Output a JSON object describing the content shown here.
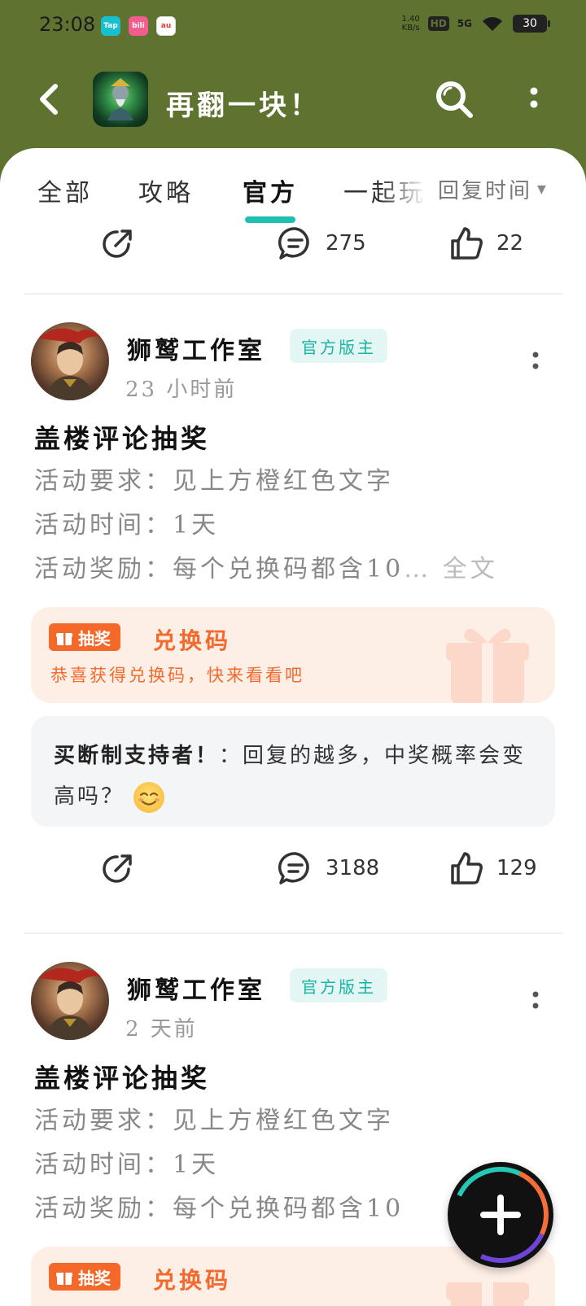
{
  "status_bar": {
    "time": "23:08",
    "apps": [
      {
        "name": "TapTap",
        "label": "Tap",
        "color": "#16c1cd"
      },
      {
        "name": "bilibili",
        "label": "bili",
        "color": "#f25d8e"
      },
      {
        "name": "au-app",
        "label": "au",
        "color": "#e63b2e"
      }
    ],
    "net_speed_top": "1.40",
    "net_speed_unit": "KB/s",
    "hd": "HD",
    "network": "5G",
    "battery": "30"
  },
  "header": {
    "game_title": "再翻一块！"
  },
  "tabs": {
    "items": [
      "全部",
      "攻略",
      "官方",
      "一起玩"
    ],
    "active_index": 2,
    "sort_label": "回复时间"
  },
  "top_actions": {
    "comments": "275",
    "likes": "22"
  },
  "posts": [
    {
      "author": "狮鹫工作室",
      "badge": "官方版主",
      "time": "23 小时前",
      "title": "盖楼评论抽奖",
      "line1": "活动要求：见上方橙红色文字",
      "line2": "活动时间：1天",
      "line3": "活动奖励：每个兑换码都含10",
      "line3_more": "…",
      "full_text": "全文",
      "lottery": {
        "tag": "抽奖",
        "title": "兑换码",
        "subtitle": "恭喜获得兑换码，快来看看吧"
      },
      "comment": {
        "author": "买断制支持者！",
        "separator": "：",
        "text": "回复的越多，中奖概率会变高吗？"
      },
      "comments": "3188",
      "likes": "129"
    },
    {
      "author": "狮鹫工作室",
      "badge": "官方版主",
      "time": "2 天前",
      "title": "盖楼评论抽奖",
      "line1": "活动要求：见上方橙红色文字",
      "line2": "活动时间：1天",
      "line3": "活动奖励：每个兑换码都含10",
      "lottery": {
        "tag": "抽奖",
        "title": "兑换码"
      }
    }
  ],
  "colors": {
    "header_bg": "#5f7330",
    "accent": "#1fbfb1",
    "lottery_orange": "#f26a2e"
  }
}
